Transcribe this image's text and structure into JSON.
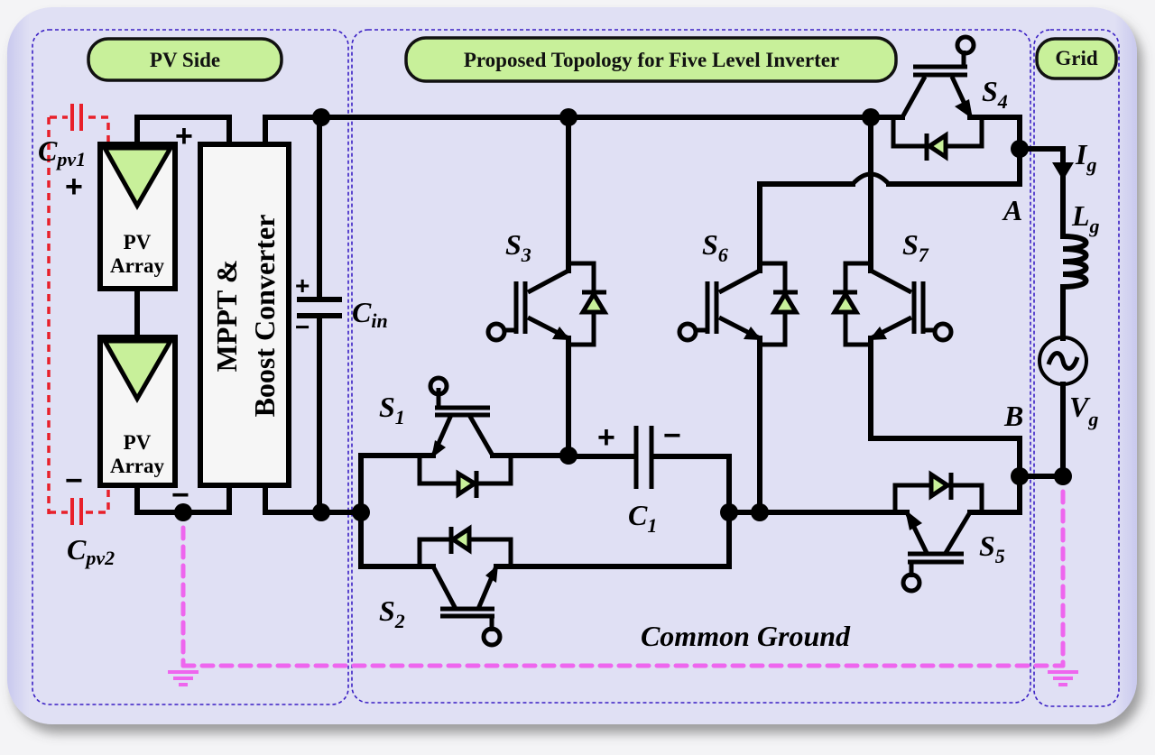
{
  "regions": {
    "pv_side": "PV Side",
    "topology": "Proposed Topology for Five Level Inverter",
    "grid": "Grid"
  },
  "pv_arrays": [
    {
      "label_line1": "PV",
      "label_line2": "Array"
    },
    {
      "label_line1": "PV",
      "label_line2": "Array"
    }
  ],
  "converter": {
    "line1": "MPPT &",
    "line2": "Boost Converter"
  },
  "capacitors": {
    "cpv1": {
      "main": "C",
      "sub": "pv1"
    },
    "cpv2": {
      "main": "C",
      "sub": "pv2"
    },
    "cin": {
      "main": "C",
      "sub": "in"
    },
    "c1": {
      "main": "C",
      "sub": "1"
    }
  },
  "switches": [
    {
      "id": "S1",
      "main": "S",
      "sub": "1"
    },
    {
      "id": "S2",
      "main": "S",
      "sub": "2"
    },
    {
      "id": "S3",
      "main": "S",
      "sub": "3"
    },
    {
      "id": "S4",
      "main": "S",
      "sub": "4"
    },
    {
      "id": "S5",
      "main": "S",
      "sub": "5"
    },
    {
      "id": "S6",
      "main": "S",
      "sub": "6"
    },
    {
      "id": "S7",
      "main": "S",
      "sub": "7"
    }
  ],
  "grid": {
    "current": {
      "main": "I",
      "sub": "g"
    },
    "inductor": {
      "main": "L",
      "sub": "g"
    },
    "voltage": {
      "main": "V",
      "sub": "g"
    },
    "node_a": "A",
    "node_b": "B"
  },
  "polarity": {
    "plus": "+",
    "minus": "−"
  },
  "common_ground": "Common Ground",
  "colors": {
    "panel": "#dcdcf2",
    "region_tag": "#c8f09a",
    "diode_fill": "#c8f09a",
    "ground_path": "#ee66ee",
    "parasitic_cap": "#e8202a",
    "region_border": "#3a1fc4"
  }
}
